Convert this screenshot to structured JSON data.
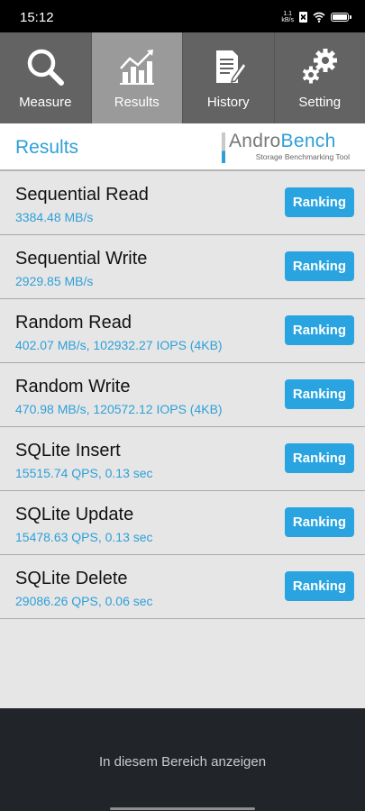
{
  "status_bar": {
    "time": "15:12",
    "net_speed_value": "1.1",
    "net_speed_unit": "kB/s"
  },
  "tabs": [
    {
      "label": "Measure",
      "icon": "magnifier-icon",
      "active": false
    },
    {
      "label": "Results",
      "icon": "bar-chart-trend-icon",
      "active": true
    },
    {
      "label": "History",
      "icon": "document-pencil-icon",
      "active": false
    },
    {
      "label": "Setting",
      "icon": "gears-icon",
      "active": false
    }
  ],
  "header": {
    "title": "Results",
    "logo_andro": "Andro",
    "logo_bench": "Bench",
    "logo_tagline": "Storage Benchmarking Tool"
  },
  "results": [
    {
      "title": "Sequential Read",
      "value": "3384.48 MB/s",
      "button": "Ranking"
    },
    {
      "title": "Sequential Write",
      "value": "2929.85 MB/s",
      "button": "Ranking"
    },
    {
      "title": "Random Read",
      "value": "402.07 MB/s, 102932.27 IOPS (4KB)",
      "button": "Ranking"
    },
    {
      "title": "Random Write",
      "value": "470.98 MB/s, 120572.12 IOPS (4KB)",
      "button": "Ranking"
    },
    {
      "title": "SQLite Insert",
      "value": "15515.74 QPS, 0.13 sec",
      "button": "Ranking"
    },
    {
      "title": "SQLite Update",
      "value": "15478.63 QPS, 0.13 sec",
      "button": "Ranking"
    },
    {
      "title": "SQLite Delete",
      "value": "29086.26 QPS, 0.06 sec",
      "button": "Ranking"
    }
  ],
  "footer": {
    "text": "In diesem Bereich anzeigen"
  },
  "colors": {
    "accent": "#2ea0d8",
    "button": "#29a4e1",
    "tabbar": "#636363",
    "tab_active": "#9a9a9a",
    "list_bg": "#e6e6e6",
    "footer_bg": "#212428"
  }
}
